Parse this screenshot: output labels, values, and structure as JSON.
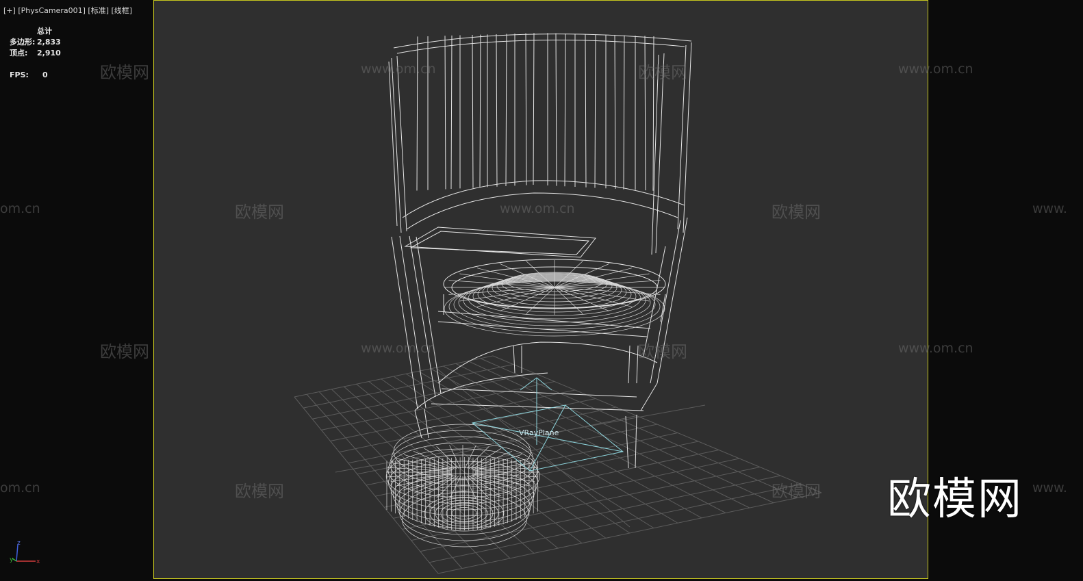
{
  "viewport_label": {
    "plus": "[+]",
    "camera": "[PhysCamera001]",
    "shading": "[标准]",
    "mode": "[线框]"
  },
  "stats": {
    "header": "总计",
    "polygons_label": "多边形:",
    "polygons_value": "2,833",
    "vertices_label": "顶点:",
    "vertices_value": "2,910",
    "fps_label": "FPS:",
    "fps_value": "0"
  },
  "object_label": "VRayPlane",
  "watermarks": {
    "cn": "欧模网",
    "url": "www.om.cn",
    "url_cut": "om.cn",
    "url_cut2": "www."
  },
  "logo": "欧模网",
  "axis": {
    "x": "x",
    "y": "y",
    "z": "z"
  },
  "colors": {
    "frame": "#c8c81e",
    "background": "#2f2f2f",
    "wire": "#e8e8e8",
    "plane": "#8fd6de"
  }
}
